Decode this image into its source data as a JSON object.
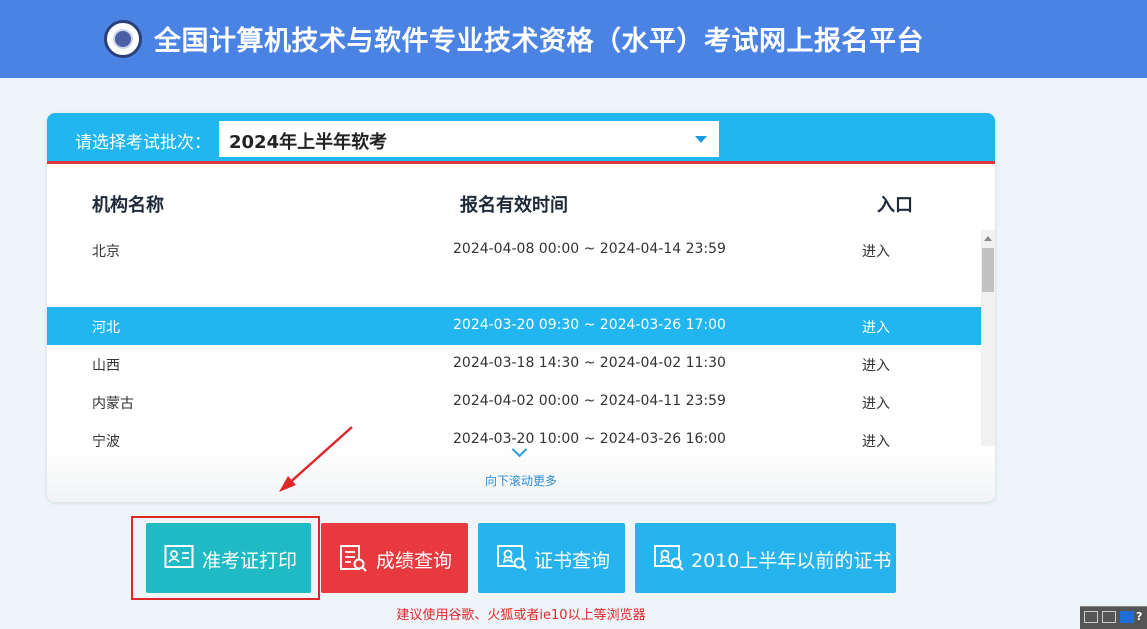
{
  "header": {
    "title": "全国计算机技术与软件专业技术资格（水平）考试网上报名平台",
    "logo_icon": "exam-seal-icon"
  },
  "batch": {
    "label": "请选择考试批次：",
    "selected": "2024年上半年软考"
  },
  "table": {
    "columns": [
      "机构名称",
      "报名有效时间",
      "入口"
    ],
    "rows": [
      {
        "name": "北京",
        "period": "2024-04-08 00:00 ~ 2024-04-14 23:59",
        "entry": "进入"
      },
      {
        "name": "河北",
        "period": "2024-03-20 09:30 ~ 2024-03-26 17:00",
        "entry": "进入"
      },
      {
        "name": "山西",
        "period": "2024-03-18 14:30 ~ 2024-04-02 11:30",
        "entry": "进入"
      },
      {
        "name": "内蒙古",
        "period": "2024-04-02 00:00 ~ 2024-04-11 23:59",
        "entry": "进入"
      },
      {
        "name": "宁波",
        "period": "2024-03-20 10:00 ~ 2024-03-26 16:00",
        "entry": "进入"
      }
    ],
    "scroll_hint": "向下滚动更多"
  },
  "buttons": {
    "admit": "准考证打印",
    "score": "成绩查询",
    "cert": "证书查询",
    "old_cert": "2010上半年以前的证书"
  },
  "note": "建议使用谷歌、火狐或者ie10以上等浏览器",
  "colors": {
    "header_bg": "#4a83e3",
    "accent_blue": "#22b6f1",
    "teal": "#1fbac4",
    "red": "#e8393f",
    "highlight_red": "#e0282b"
  }
}
